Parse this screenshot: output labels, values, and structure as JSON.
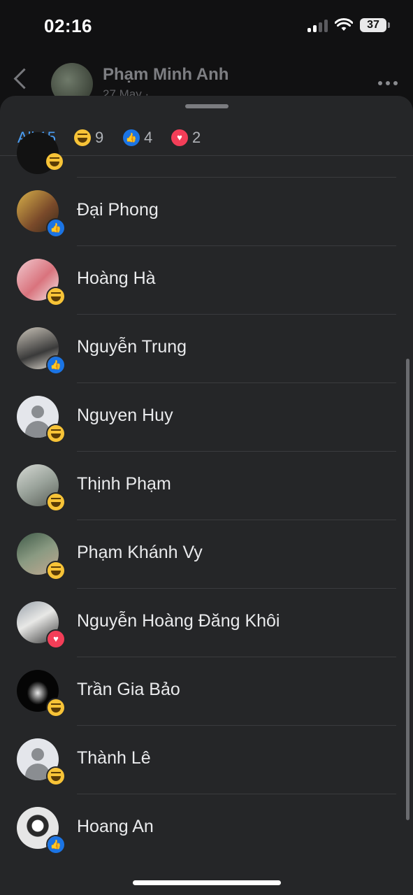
{
  "status_bar": {
    "time": "02:16",
    "battery": "37"
  },
  "post": {
    "author": "Phạm Minh Anh",
    "meta": "27 May ·"
  },
  "tabs": [
    {
      "label": "All 15",
      "icon": "",
      "active": true
    },
    {
      "label": "9",
      "icon": "haha-reaction-icon"
    },
    {
      "label": "4",
      "icon": "like-reaction-icon"
    },
    {
      "label": "2",
      "icon": "love-reaction-icon"
    }
  ],
  "reactors": [
    {
      "name": "Đại Phong",
      "reaction": "like"
    },
    {
      "name": "Hoàng Hà",
      "reaction": "haha"
    },
    {
      "name": "Nguyễn Trung",
      "reaction": "like"
    },
    {
      "name": "Nguyen Huy",
      "reaction": "haha"
    },
    {
      "name": "Thịnh Phạm",
      "reaction": "haha"
    },
    {
      "name": "Phạm Khánh Vy",
      "reaction": "haha"
    },
    {
      "name": "Nguyễn Hoàng Đăng Khôi",
      "reaction": "love"
    },
    {
      "name": "Trần Gia Bảo",
      "reaction": "haha"
    },
    {
      "name": "Thành Lê",
      "reaction": "haha"
    },
    {
      "name": "Hoang An",
      "reaction": "like"
    }
  ],
  "colors": {
    "accent": "#4a9ef5",
    "like": "#1b74e4",
    "love": "#f33e58",
    "haha": "#f7c337"
  }
}
